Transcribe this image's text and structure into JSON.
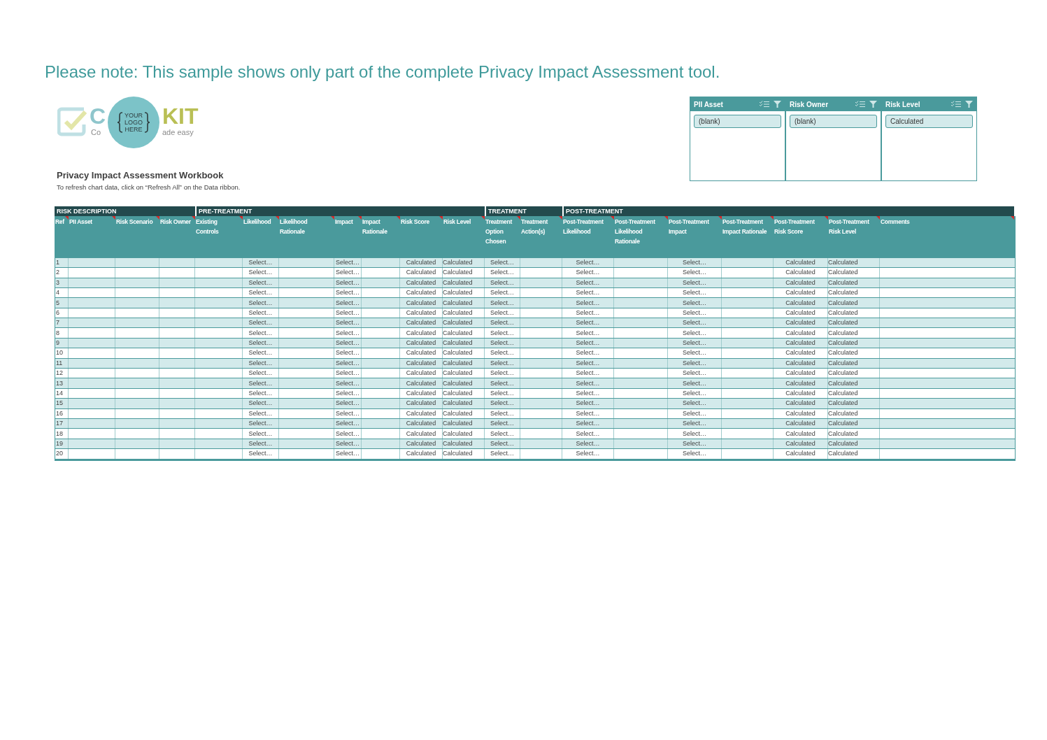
{
  "notice": "Please note: This sample shows only part of the complete Privacy Impact Assessment tool.",
  "logo": {
    "badge_lines": [
      "YOUR",
      "LOGO",
      "HERE"
    ],
    "faded_word_left": "C",
    "faded_word_right": "KIT",
    "faded_tagline_left": "Co",
    "faded_tagline_right": "ade easy"
  },
  "workbook": {
    "title": "Privacy Impact Assessment Workbook",
    "hint": "To refresh chart data, click on “Refresh All” on the Data ribbon."
  },
  "slicers": [
    {
      "title": "PII Asset",
      "items": [
        {
          "label": "(blank)",
          "selected": true
        }
      ]
    },
    {
      "title": "Risk Owner",
      "items": [
        {
          "label": "(blank)",
          "selected": true
        }
      ]
    },
    {
      "title": "Risk Level",
      "items": [
        {
          "label": "Calculated",
          "selected": true
        }
      ]
    }
  ],
  "table": {
    "groups": [
      "RISK DESCRIPTION",
      "PRE-TREATMENT",
      "TREATMENT",
      "POST-TREATMENT"
    ],
    "columns": [
      {
        "label": "Ref",
        "note": true
      },
      {
        "label": "PII Asset",
        "note": true
      },
      {
        "label": "Risk Scenario",
        "note": true
      },
      {
        "label": "Risk Owner",
        "note": true
      },
      {
        "label": "Existing Controls",
        "note": true
      },
      {
        "label": "Likelihood",
        "note": true
      },
      {
        "label": "Likelihood Rationale",
        "note": true
      },
      {
        "label": "Impact",
        "note": true
      },
      {
        "label": "Impact Rationale",
        "note": true
      },
      {
        "label": "Risk Score",
        "note": true
      },
      {
        "label": "Risk Level",
        "note": true
      },
      {
        "label": "Treatment Option Chosen",
        "note": true
      },
      {
        "label": "Treatment Action(s)",
        "note": true
      },
      {
        "label": "Post-Treatment Likelihood",
        "note": true
      },
      {
        "label": "Post-Treatment Likelihood Rationale",
        "note": true
      },
      {
        "label": "Post-Treatment Impact",
        "note": true
      },
      {
        "label": "Post-Treatment Impact Rationale",
        "note": true
      },
      {
        "label": "Post-Treatment Risk Score",
        "note": true
      },
      {
        "label": "Post-Treatment Risk Level",
        "note": true
      },
      {
        "label": "Comments",
        "note": true
      }
    ],
    "rows": [
      {
        "cells": [
          "1",
          "",
          "",
          "",
          "",
          "Select…",
          "",
          "Select…",
          "",
          "Calculated",
          "Calculated",
          "Select…",
          "",
          "Select…",
          "",
          "Select…",
          "",
          "Calculated",
          "Calculated"
        ]
      },
      {
        "cells": [
          "2",
          "",
          "",
          "",
          "",
          "Select…",
          "",
          "Select…",
          "",
          "Calculated",
          "Calculated",
          "Select…",
          "",
          "Select…",
          "",
          "Select…",
          "",
          "Calculated",
          "Calculated"
        ]
      },
      {
        "cells": [
          "3",
          "",
          "",
          "",
          "",
          "Select…",
          "",
          "Select…",
          "",
          "Calculated",
          "Calculated",
          "Select…",
          "",
          "Select…",
          "",
          "Select…",
          "",
          "Calculated",
          "Calculated"
        ]
      },
      {
        "cells": [
          "4",
          "",
          "",
          "",
          "",
          "Select…",
          "",
          "Select…",
          "",
          "Calculated",
          "Calculated",
          "Select…",
          "",
          "Select…",
          "",
          "Select…",
          "",
          "Calculated",
          "Calculated"
        ]
      },
      {
        "cells": [
          "5",
          "",
          "",
          "",
          "",
          "Select…",
          "",
          "Select…",
          "",
          "Calculated",
          "Calculated",
          "Select…",
          "",
          "Select…",
          "",
          "Select…",
          "",
          "Calculated",
          "Calculated"
        ]
      },
      {
        "cells": [
          "6",
          "",
          "",
          "",
          "",
          "Select…",
          "",
          "Select…",
          "",
          "Calculated",
          "Calculated",
          "Select…",
          "",
          "Select…",
          "",
          "Select…",
          "",
          "Calculated",
          "Calculated"
        ]
      },
      {
        "cells": [
          "7",
          "",
          "",
          "",
          "",
          "Select…",
          "",
          "Select…",
          "",
          "Calculated",
          "Calculated",
          "Select…",
          "",
          "Select…",
          "",
          "Select…",
          "",
          "Calculated",
          "Calculated"
        ]
      },
      {
        "cells": [
          "8",
          "",
          "",
          "",
          "",
          "Select…",
          "",
          "Select…",
          "",
          "Calculated",
          "Calculated",
          "Select…",
          "",
          "Select…",
          "",
          "Select…",
          "",
          "Calculated",
          "Calculated"
        ]
      },
      {
        "cells": [
          "9",
          "",
          "",
          "",
          "",
          "Select…",
          "",
          "Select…",
          "",
          "Calculated",
          "Calculated",
          "Select…",
          "",
          "Select…",
          "",
          "Select…",
          "",
          "Calculated",
          "Calculated"
        ]
      },
      {
        "cells": [
          "10",
          "",
          "",
          "",
          "",
          "Select…",
          "",
          "Select…",
          "",
          "Calculated",
          "Calculated",
          "Select…",
          "",
          "Select…",
          "",
          "Select…",
          "",
          "Calculated",
          "Calculated"
        ]
      },
      {
        "cells": [
          "11",
          "",
          "",
          "",
          "",
          "Select…",
          "",
          "Select…",
          "",
          "Calculated",
          "Calculated",
          "Select…",
          "",
          "Select…",
          "",
          "Select…",
          "",
          "Calculated",
          "Calculated"
        ]
      },
      {
        "cells": [
          "12",
          "",
          "",
          "",
          "",
          "Select…",
          "",
          "Select…",
          "",
          "Calculated",
          "Calculated",
          "Select…",
          "",
          "Select…",
          "",
          "Select…",
          "",
          "Calculated",
          "Calculated"
        ]
      },
      {
        "cells": [
          "13",
          "",
          "",
          "",
          "",
          "Select…",
          "",
          "Select…",
          "",
          "Calculated",
          "Calculated",
          "Select…",
          "",
          "Select…",
          "",
          "Select…",
          "",
          "Calculated",
          "Calculated"
        ]
      },
      {
        "cells": [
          "14",
          "",
          "",
          "",
          "",
          "Select…",
          "",
          "Select…",
          "",
          "Calculated",
          "Calculated",
          "Select…",
          "",
          "Select…",
          "",
          "Select…",
          "",
          "Calculated",
          "Calculated"
        ]
      },
      {
        "cells": [
          "15",
          "",
          "",
          "",
          "",
          "Select…",
          "",
          "Select…",
          "",
          "Calculated",
          "Calculated",
          "Select…",
          "",
          "Select…",
          "",
          "Select…",
          "",
          "Calculated",
          "Calculated"
        ]
      },
      {
        "cells": [
          "16",
          "",
          "",
          "",
          "",
          "Select…",
          "",
          "Select…",
          "",
          "Calculated",
          "Calculated",
          "Select…",
          "",
          "Select…",
          "",
          "Select…",
          "",
          "Calculated",
          "Calculated"
        ]
      },
      {
        "cells": [
          "17",
          "",
          "",
          "",
          "",
          "Select…",
          "",
          "Select…",
          "",
          "Calculated",
          "Calculated",
          "Select…",
          "",
          "Select…",
          "",
          "Select…",
          "",
          "Calculated",
          "Calculated"
        ]
      },
      {
        "cells": [
          "18",
          "",
          "",
          "",
          "",
          "Select…",
          "",
          "Select…",
          "",
          "Calculated",
          "Calculated",
          "Select…",
          "",
          "Select…",
          "",
          "Select…",
          "",
          "Calculated",
          "Calculated"
        ]
      },
      {
        "cells": [
          "19",
          "",
          "",
          "",
          "",
          "Select…",
          "",
          "Select…",
          "",
          "Calculated",
          "Calculated",
          "Select…",
          "",
          "Select…",
          "",
          "Select…",
          "",
          "Calculated",
          "Calculated"
        ]
      },
      {
        "cells": [
          "20",
          "",
          "",
          "",
          "",
          "Select…",
          "",
          "Select…",
          "",
          "Calculated",
          "Calculated",
          "Select…",
          "",
          "Select…",
          "",
          "Select…",
          "",
          "Calculated",
          "Calculated"
        ]
      }
    ]
  }
}
